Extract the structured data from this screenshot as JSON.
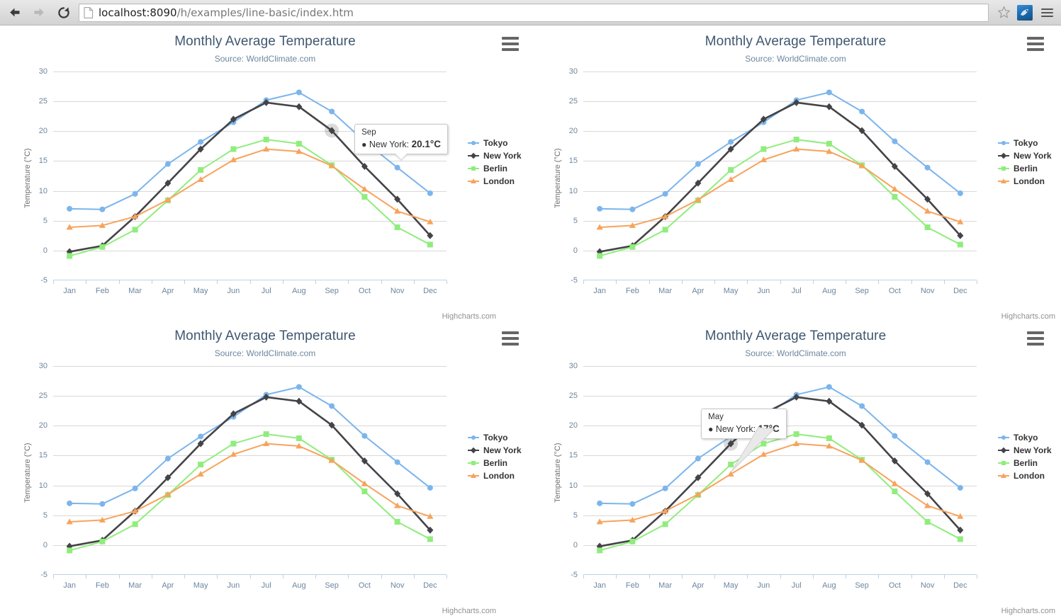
{
  "browser": {
    "back_icon": "back-arrow-icon",
    "forward_icon": "forward-arrow-icon",
    "reload_icon": "reload-icon",
    "page_icon": "page-document-icon",
    "url_host": "localhost:8090",
    "url_path": "/h/examples/line-basic/index.htm",
    "url_full": "localhost:8090/h/examples/line-basic/index.htm",
    "star_icon": "bookmark-star-icon",
    "extension_icon": "extension-icon",
    "menu_icon": "chrome-menu-icon"
  },
  "chart_common": {
    "title": "Monthly Average Temperature",
    "subtitle": "Source: WorldClimate.com",
    "credits": "Highcharts.com",
    "export_icon": "export-menu-icon"
  },
  "chart_data": {
    "type": "line",
    "title": "Monthly Average Temperature",
    "subtitle": "Source: WorldClimate.com",
    "xlabel": "",
    "ylabel": "Temperature (°C)",
    "categories": [
      "Jan",
      "Feb",
      "Mar",
      "Apr",
      "May",
      "Jun",
      "Jul",
      "Aug",
      "Sep",
      "Oct",
      "Nov",
      "Dec"
    ],
    "ylim": [
      -5,
      30
    ],
    "ytick_labels": [
      "-5",
      "0",
      "5",
      "10",
      "15",
      "20",
      "25",
      "30"
    ],
    "ytick_values": [
      -5,
      0,
      5,
      10,
      15,
      20,
      25,
      30
    ],
    "grid": true,
    "legend_position": "right-middle",
    "series": [
      {
        "name": "Tokyo",
        "color": "#7cb5ec",
        "marker": "circle",
        "values": [
          7.0,
          6.9,
          9.5,
          14.5,
          18.2,
          21.5,
          25.2,
          26.5,
          23.3,
          18.3,
          13.9,
          9.6
        ]
      },
      {
        "name": "New York",
        "color": "#434348",
        "marker": "diamond",
        "values": [
          -0.2,
          0.8,
          5.7,
          11.3,
          17.0,
          22.0,
          24.8,
          24.1,
          20.1,
          14.1,
          8.6,
          2.5
        ]
      },
      {
        "name": "Berlin",
        "color": "#90ed7d",
        "marker": "square",
        "values": [
          -0.9,
          0.6,
          3.5,
          8.4,
          13.5,
          17.0,
          18.6,
          17.9,
          14.3,
          9.0,
          3.9,
          1.0
        ]
      },
      {
        "name": "London",
        "color": "#f7a35c",
        "marker": "triangle",
        "values": [
          3.9,
          4.2,
          5.7,
          8.5,
          11.9,
          15.2,
          17.0,
          16.6,
          14.2,
          10.3,
          6.6,
          4.8
        ]
      }
    ]
  },
  "charts": [
    {
      "id": "chart-top-left",
      "tooltip": {
        "visible": true,
        "month": "Sep",
        "series": "New York",
        "value": "20.1°C",
        "label": "New York: ",
        "pointer": "down"
      }
    },
    {
      "id": "chart-top-right",
      "tooltip": {
        "visible": false
      }
    },
    {
      "id": "chart-bottom-left",
      "tooltip": {
        "visible": false
      }
    },
    {
      "id": "chart-bottom-right",
      "tooltip": {
        "visible": true,
        "month": "May",
        "series": "New York",
        "value": "17°C",
        "label": "New York: ",
        "pointer": "diagonal"
      }
    }
  ],
  "legend": {
    "items": [
      {
        "label": "Tokyo",
        "color": "#7cb5ec"
      },
      {
        "label": "New York",
        "color": "#434348"
      },
      {
        "label": "Berlin",
        "color": "#90ed7d"
      },
      {
        "label": "London",
        "color": "#f7a35c"
      }
    ]
  }
}
